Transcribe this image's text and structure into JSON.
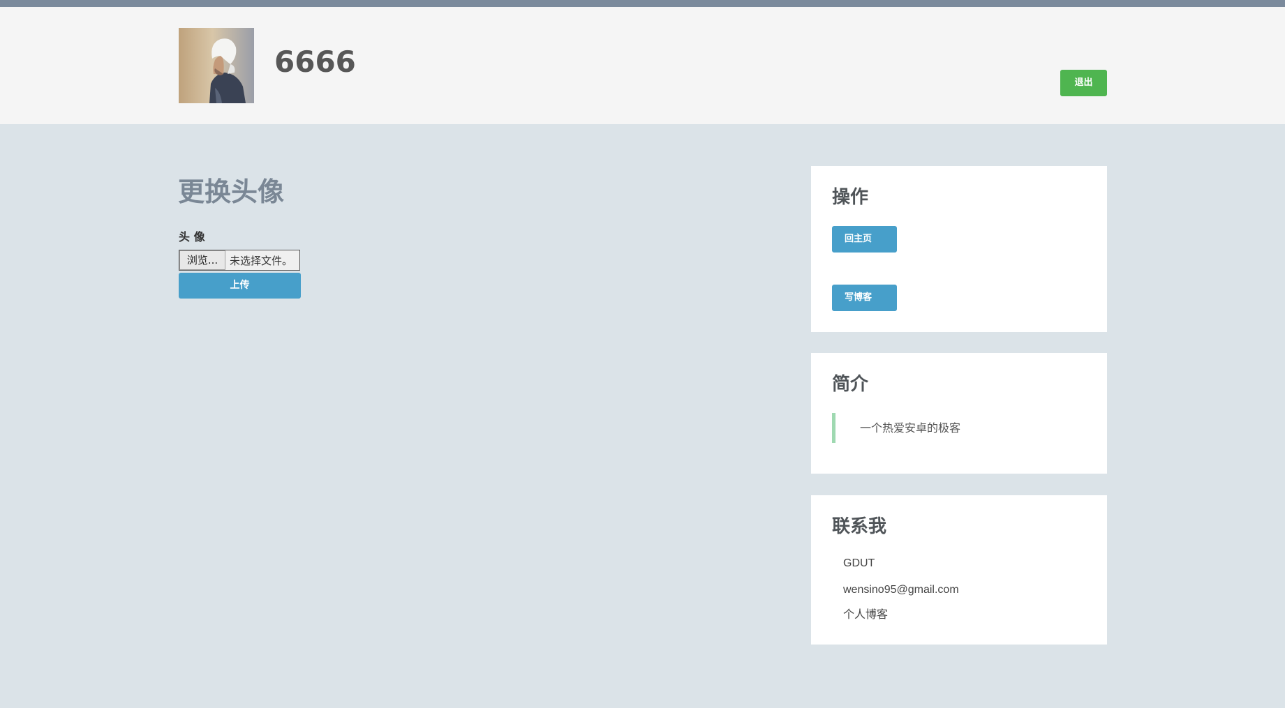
{
  "header": {
    "username": "6666",
    "logout_label": "退出"
  },
  "main": {
    "title": "更换头像",
    "avatar_label": "头 像",
    "file_input": {
      "browse_label": "浏览...",
      "status": "未选择文件。"
    },
    "upload_label": "上传"
  },
  "sidebar": {
    "operations": {
      "title": "操作",
      "home_label": "回主页",
      "write_label": "写博客"
    },
    "intro": {
      "title": "简介",
      "text": "一个热爱安卓的极客"
    },
    "contact": {
      "title": "联系我",
      "school": "GDUT",
      "email": "wensino95@gmail.com",
      "blog_link": "个人博客"
    }
  },
  "colors": {
    "page_bg": "#dbe3e8",
    "header_bg": "#f5f5f5",
    "top_strip": "#7b8a9c",
    "logout_green": "#4fb550",
    "primary_blue": "#479fca",
    "quote_border": "#9fd9b1"
  }
}
